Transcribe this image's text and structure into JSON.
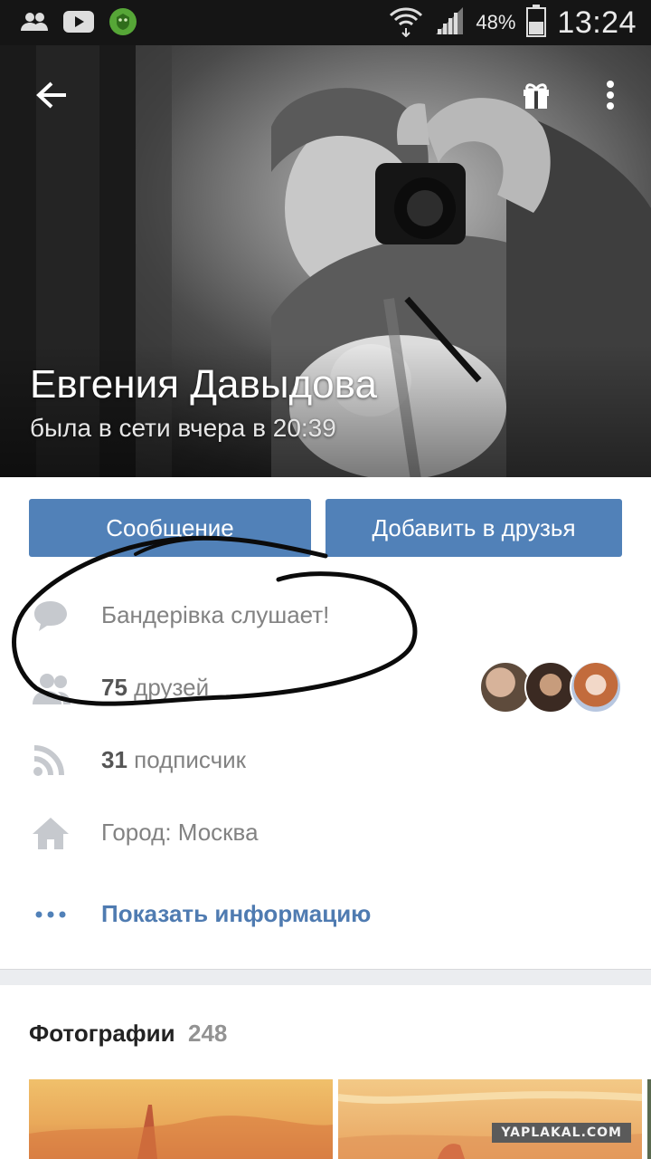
{
  "status_bar": {
    "battery_percent": "48%",
    "time": "13:24"
  },
  "profile": {
    "name": "Евгения Давыдова",
    "last_seen": "была в сети вчера в 20:39"
  },
  "actions": {
    "message_label": "Сообщение",
    "add_friend_label": "Добавить в друзья"
  },
  "info": {
    "status_text": "Бандерівка слушает!",
    "friends_count": "75",
    "friends_label": "друзей",
    "followers_count": "31",
    "followers_label": "подписчик",
    "city_text": "Город: Москва",
    "show_info_label": "Показать информацию"
  },
  "photos": {
    "title": "Фотографии",
    "count": "248"
  },
  "watermark": "YAPLAKAL.COM",
  "colors": {
    "accent": "#5181b8",
    "link": "#4f7bb1",
    "secondary_text": "#828282"
  },
  "icons": [
    "group-icon",
    "youtube-icon",
    "shield-icon",
    "wifi-icon",
    "signal-icon",
    "battery-icon",
    "back-arrow-icon",
    "gift-icon",
    "more-vertical-icon",
    "speech-bubble-icon",
    "friends-icon",
    "rss-icon",
    "home-icon",
    "more-horizontal-icon"
  ]
}
